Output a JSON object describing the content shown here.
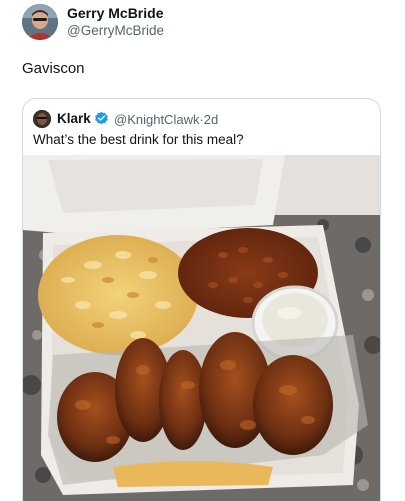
{
  "post": {
    "author_name": "Gerry McBride",
    "author_handle": "@GerryMcBride",
    "text": "Gaviscon"
  },
  "quoted_post": {
    "author_name": "Klark",
    "author_handle": "@KnightClawk",
    "separator": "·",
    "age": "2d",
    "text": "What’s the best drink for this meal?"
  },
  "colors": {
    "verified_badge": "#1d9bf0",
    "secondary_text": "#536471",
    "border": "#cfd9de"
  },
  "icons": {
    "verified": "verified-badge-icon"
  }
}
